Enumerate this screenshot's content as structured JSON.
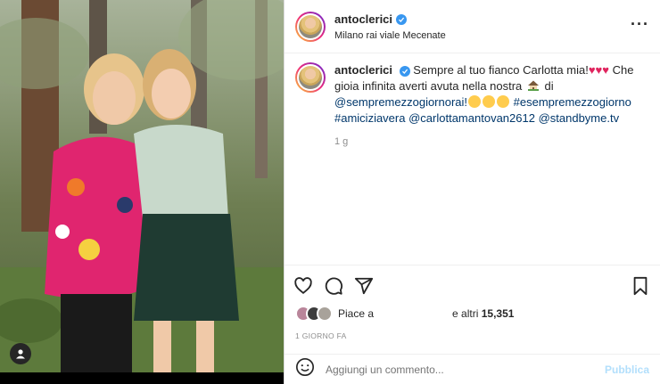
{
  "post": {
    "username": "antoclerici",
    "location": "Milano rai viale Mecenate",
    "caption": {
      "username": "antoclerici",
      "text_1": "Sempre al tuo fianco Carlotta mia!",
      "text_2": "Che gioia infinita averti avuta nella nostra",
      "text_3": "di",
      "tag_1": "@sempremezzogiornorai!",
      "hashtag_1": "#esempremezzogiorno",
      "hashtag_2": "#amiciziavera",
      "tag_2": "@carlottamantovan2612",
      "tag_3": "@standbyme.tv",
      "time_ago": "1 g"
    },
    "likes": {
      "prefix": "Piace a",
      "suffix_pre": "e altri",
      "count": "15,351"
    },
    "date": "1 GIORNO FA",
    "comment_placeholder": "Aggiungi un commento...",
    "publish_label": "Pubblica"
  },
  "colors": {
    "link": "#00376b",
    "heart": "#e0245e",
    "verified": "#3897f0",
    "publish_disabled": "#b2dffc"
  },
  "icons": {
    "more": "more-options-icon",
    "like": "heart-icon",
    "comment": "comment-icon",
    "share": "share-icon",
    "save": "bookmark-icon",
    "emoji": "emoji-icon",
    "user_tag": "user-tag-icon"
  }
}
